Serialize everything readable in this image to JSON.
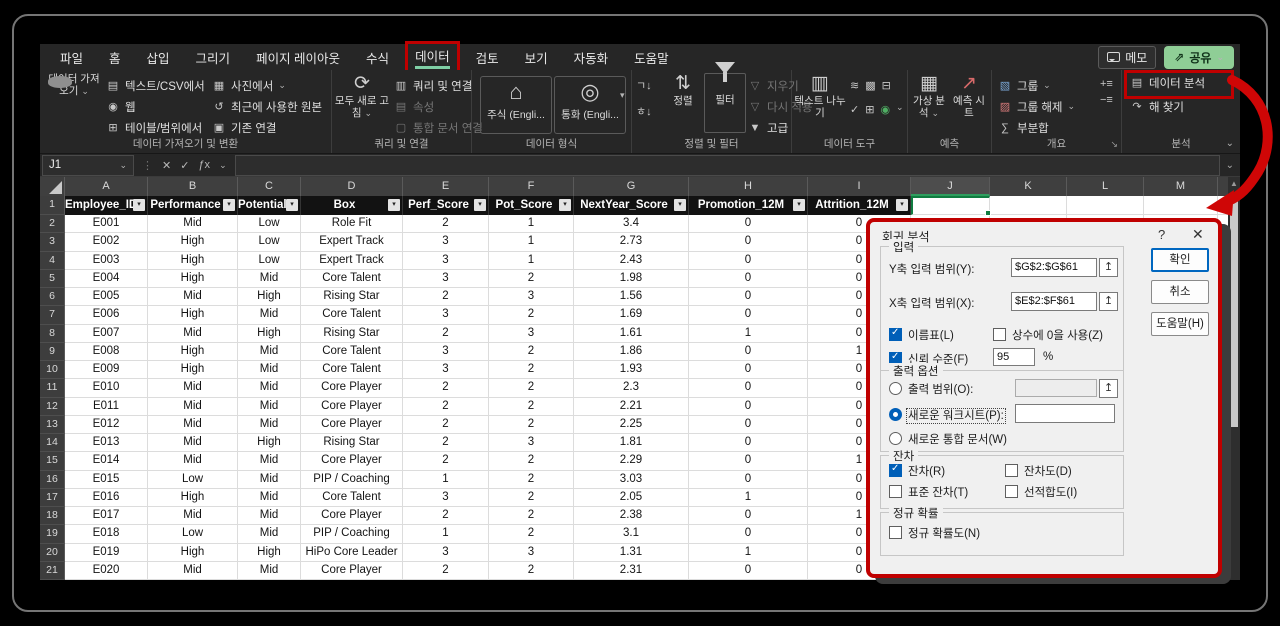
{
  "menu": {
    "tabs": [
      {
        "label": "파일"
      },
      {
        "label": "홈"
      },
      {
        "label": "삽입"
      },
      {
        "label": "그리기"
      },
      {
        "label": "페이지 레이아웃"
      },
      {
        "label": "수식"
      },
      {
        "label": "데이터"
      },
      {
        "label": "검토"
      },
      {
        "label": "보기"
      },
      {
        "label": "자동화"
      },
      {
        "label": "도움말"
      }
    ],
    "memo": "메모",
    "share": "공유"
  },
  "ribbon": {
    "chev": "⌄",
    "groups": [
      {
        "label": "데이터 가져오기 및 변환"
      },
      {
        "label": "쿼리 및 연결"
      },
      {
        "label": "데이터 형식"
      },
      {
        "label": "정렬 및 필터"
      },
      {
        "label": "데이터 도구"
      },
      {
        "label": "예측"
      },
      {
        "label": "개요"
      },
      {
        "label": "분석"
      }
    ],
    "get_data": {
      "label": "데이터 가져오기"
    },
    "items_g1": [
      {
        "label": "텍스트/CSV에서",
        "glyph": "▤"
      },
      {
        "label": "웹",
        "glyph": "◉"
      },
      {
        "label": "테이블/범위에서",
        "glyph": "⊞"
      },
      {
        "label": "사진에서",
        "glyph": "▦"
      },
      {
        "label": "최근에 사용한 원본",
        "glyph": "↺"
      },
      {
        "label": "기존 연결",
        "glyph": "▣"
      }
    ],
    "refresh_all": {
      "label": "모두 새로 고침",
      "glyph": "⟳"
    },
    "items_g2": [
      {
        "label": "쿼리 및 연결",
        "glyph": "▥"
      },
      {
        "label": "속성",
        "glyph": "▤"
      },
      {
        "label": "통합 문서 연결",
        "glyph": "▢"
      }
    ],
    "stocks": {
      "label": "주식 (Engli...",
      "glyph": "⌂"
    },
    "currency": {
      "label": "통화 (Engli...",
      "glyph": "◎"
    },
    "sort_asc_glyph": "ㄱ↓",
    "sort_desc_glyph": "ㅎ↓",
    "sort": {
      "label": "정렬",
      "glyph": "⇅"
    },
    "filter": {
      "label": "필터"
    },
    "items_filter": [
      {
        "label": "지우기",
        "glyph": "▽"
      },
      {
        "label": "다시 적용",
        "glyph": "▽"
      },
      {
        "label": "고급",
        "glyph": "▼"
      }
    ],
    "text_to_columns": {
      "label": "텍스트 나누기",
      "glyph": "▥"
    },
    "data_tools_icons": [
      {
        "name": "flash-fill",
        "glyph": "≋"
      },
      {
        "name": "remove-duplicates",
        "glyph": "▩"
      },
      {
        "name": "consolidate",
        "glyph": "⊟"
      },
      {
        "name": "data-validation",
        "glyph": "✓"
      },
      {
        "name": "relationships",
        "glyph": "⊞"
      },
      {
        "name": "manage-data-model",
        "glyph": "◉"
      }
    ],
    "what_if": {
      "label": "가상 분석",
      "glyph": "▦"
    },
    "forecast_sheet": {
      "label": "예측 시트",
      "glyph": "↗"
    },
    "items_outline": [
      {
        "label": "그룹",
        "glyph": "▧"
      },
      {
        "label": "그룹 해제",
        "glyph": "▨"
      },
      {
        "label": "부분합",
        "glyph": "∑"
      }
    ],
    "outline_small": [
      "+≡",
      "−≡"
    ],
    "analysis_items": [
      {
        "label": "데이터 분석",
        "glyph": "▤"
      },
      {
        "label": "해 찾기",
        "glyph": "↷"
      }
    ],
    "dialog_launcher": "↘",
    "collapse_chev": "⌄"
  },
  "formula_bar": {
    "name_box": "J1",
    "cancel": "✕",
    "enter": "✓",
    "fx": "ƒx",
    "value": ""
  },
  "sheet": {
    "columns": [
      "A",
      "B",
      "C",
      "D",
      "E",
      "F",
      "G",
      "H",
      "I",
      "J",
      "K",
      "L",
      "M"
    ],
    "header_row": [
      "Employee_ID",
      "Performance",
      "Potential",
      "Box",
      "Perf_Score",
      "Pot_Score",
      "NextYear_Score",
      "Promotion_12M",
      "Attrition_12M"
    ],
    "filter_glyph": "▾",
    "selected_cell": "J1",
    "rows": [
      [
        "E001",
        "Mid",
        "Low",
        "Role Fit",
        "2",
        "1",
        "3.4",
        "0",
        "0"
      ],
      [
        "E002",
        "High",
        "Low",
        "Expert Track",
        "3",
        "1",
        "2.73",
        "0",
        "0"
      ],
      [
        "E003",
        "High",
        "Low",
        "Expert Track",
        "3",
        "1",
        "2.43",
        "0",
        "0"
      ],
      [
        "E004",
        "High",
        "Mid",
        "Core Talent",
        "3",
        "2",
        "1.98",
        "0",
        "0"
      ],
      [
        "E005",
        "Mid",
        "High",
        "Rising Star",
        "2",
        "3",
        "1.56",
        "0",
        "0"
      ],
      [
        "E006",
        "High",
        "Mid",
        "Core Talent",
        "3",
        "2",
        "1.69",
        "0",
        "0"
      ],
      [
        "E007",
        "Mid",
        "High",
        "Rising Star",
        "2",
        "3",
        "1.61",
        "1",
        "0"
      ],
      [
        "E008",
        "High",
        "Mid",
        "Core Talent",
        "3",
        "2",
        "1.86",
        "0",
        "1"
      ],
      [
        "E009",
        "High",
        "Mid",
        "Core Talent",
        "3",
        "2",
        "1.93",
        "0",
        "0"
      ],
      [
        "E010",
        "Mid",
        "Mid",
        "Core Player",
        "2",
        "2",
        "2.3",
        "0",
        "0"
      ],
      [
        "E011",
        "Mid",
        "Mid",
        "Core Player",
        "2",
        "2",
        "2.21",
        "0",
        "0"
      ],
      [
        "E012",
        "Mid",
        "Mid",
        "Core Player",
        "2",
        "2",
        "2.25",
        "0",
        "0"
      ],
      [
        "E013",
        "Mid",
        "High",
        "Rising Star",
        "2",
        "3",
        "1.81",
        "0",
        "0"
      ],
      [
        "E014",
        "Mid",
        "Mid",
        "Core Player",
        "2",
        "2",
        "2.29",
        "0",
        "1"
      ],
      [
        "E015",
        "Low",
        "Mid",
        "PIP / Coaching",
        "1",
        "2",
        "3.03",
        "0",
        "0"
      ],
      [
        "E016",
        "High",
        "Mid",
        "Core Talent",
        "3",
        "2",
        "2.05",
        "1",
        "0"
      ],
      [
        "E017",
        "Mid",
        "Mid",
        "Core Player",
        "2",
        "2",
        "2.38",
        "0",
        "1"
      ],
      [
        "E018",
        "Low",
        "Mid",
        "PIP / Coaching",
        "1",
        "2",
        "3.1",
        "0",
        "0"
      ],
      [
        "E019",
        "High",
        "High",
        "HiPo Core Leader",
        "3",
        "3",
        "1.31",
        "1",
        "0"
      ],
      [
        "E020",
        "Mid",
        "Mid",
        "Core Player",
        "2",
        "2",
        "2.31",
        "0",
        "0"
      ]
    ]
  },
  "dialog": {
    "title": "회귀 분석",
    "help": "?",
    "close": "✕",
    "range_icon": "↥",
    "input": {
      "label": "입력",
      "y_label": "Y축 입력 범위(Y):",
      "y_value": "$G$2:$G$61",
      "x_label": "X축 입력 범위(X):",
      "x_value": "$E$2:$F$61",
      "labels_cb": "이름표(L)",
      "const_zero_cb": "상수에 0을 사용(Z)",
      "confidence_cb": "신뢰 수준(F)",
      "confidence_value": "95",
      "confidence_unit": "%"
    },
    "buttons": {
      "ok": "확인",
      "cancel": "취소",
      "help": "도움말(H)"
    },
    "output": {
      "label": "출력 옵션",
      "range_label": "출력 범위(O):",
      "new_sheet_label": "새로운 워크시트(P):",
      "new_book_label": "새로운 통합 문서(W)"
    },
    "residuals": {
      "label": "잔차",
      "r": "잔차(R)",
      "std": "표준 잔차(T)",
      "plot": "잔차도(D)",
      "fit": "선적합도(I)"
    },
    "normal": {
      "label": "정규 확률",
      "np": "정규 확률도(N)"
    },
    "colors": {
      "annotation_red": "#c00000",
      "checkbox_blue": "#005fb8",
      "ok_border_blue": "#0067c0"
    }
  },
  "accents": {
    "excel_green": "#107c41",
    "share_green": "#8fce96",
    "tab_underline": "#7fcfa5"
  }
}
